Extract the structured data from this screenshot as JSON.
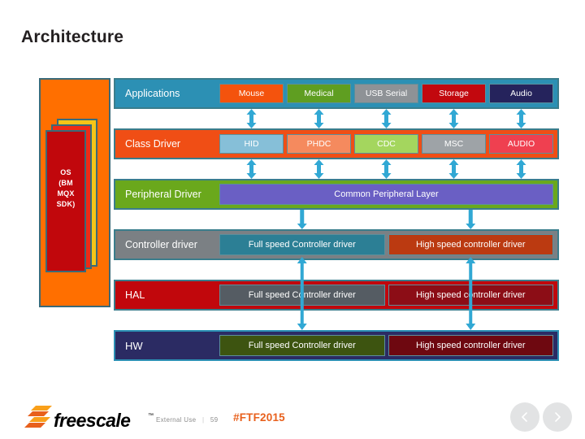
{
  "slide": {
    "title": "Architecture"
  },
  "os_stack": {
    "label": "OS (BM MQX SDK)",
    "label_lines": [
      "OS",
      "(BM",
      "MQX",
      "SDK)"
    ],
    "colors": {
      "outer": "#ff6f00",
      "yellow": "#f5c518",
      "red": "#ef2b16",
      "inner": "#c1070c"
    }
  },
  "rows": [
    {
      "name": "applications",
      "label": "Applications",
      "color": "#2c90b4",
      "cells": [
        {
          "label": "Mouse",
          "color": "#f4530d"
        },
        {
          "label": "Medical",
          "color": "#5f9e21"
        },
        {
          "label": "USB Serial",
          "color": "#8e9296"
        },
        {
          "label": "Storage",
          "color": "#c2080e"
        },
        {
          "label": "Audio",
          "color": "#25235c"
        }
      ]
    },
    {
      "name": "class-driver",
      "label": "Class Driver",
      "color": "#f04e15",
      "cells": [
        {
          "label": "HID",
          "color": "#86bfd8"
        },
        {
          "label": "PHDC",
          "color": "#f58a5e"
        },
        {
          "label": "CDC",
          "color": "#a4d champ"
        },
        {
          "label": "MSC",
          "color": "#9ea3a7"
        },
        {
          "label": "AUDIO",
          "color": "#ef4050"
        }
      ]
    },
    {
      "name": "peripheral-driver",
      "label": "Peripheral Driver",
      "color": "#6aa81c",
      "cells": [
        {
          "label": "Common Peripheral Layer",
          "color": "#6a5fc4"
        }
      ]
    },
    {
      "name": "controller-driver",
      "label": "Controller driver",
      "color": "#7b8084",
      "cells": [
        {
          "label": "Full speed Controller driver",
          "color": "#2c7f95"
        },
        {
          "label": "High speed controller driver",
          "color": "#bb3a11"
        }
      ]
    },
    {
      "name": "hal",
      "label": "HAL",
      "color": "#c1070c",
      "cells": [
        {
          "label": "Full speed Controller driver",
          "color": "#555c63"
        },
        {
          "label": "High speed controller driver",
          "color": "#8c0d16"
        }
      ]
    },
    {
      "name": "hw",
      "label": "HW",
      "color": "#2b2b63",
      "cells": [
        {
          "label": "Full speed Controller driver",
          "color": "#3d5410"
        },
        {
          "label": "High speed controller driver",
          "color": "#6e0810"
        }
      ]
    }
  ],
  "connectors": {
    "color": "#31a8d4",
    "apps_to_class": 5,
    "class_to_peripheral": 5,
    "peripheral_to_controller": 2,
    "controller_to_hw": 2
  },
  "footer": {
    "logo_text": "freescale",
    "logo_tm": "™",
    "external_use": "External Use",
    "divider": "|",
    "page_number": "59",
    "hashtag": "#FTF2015",
    "prev_icon": "chevron-left-icon",
    "next_icon": "chevron-right-icon"
  }
}
